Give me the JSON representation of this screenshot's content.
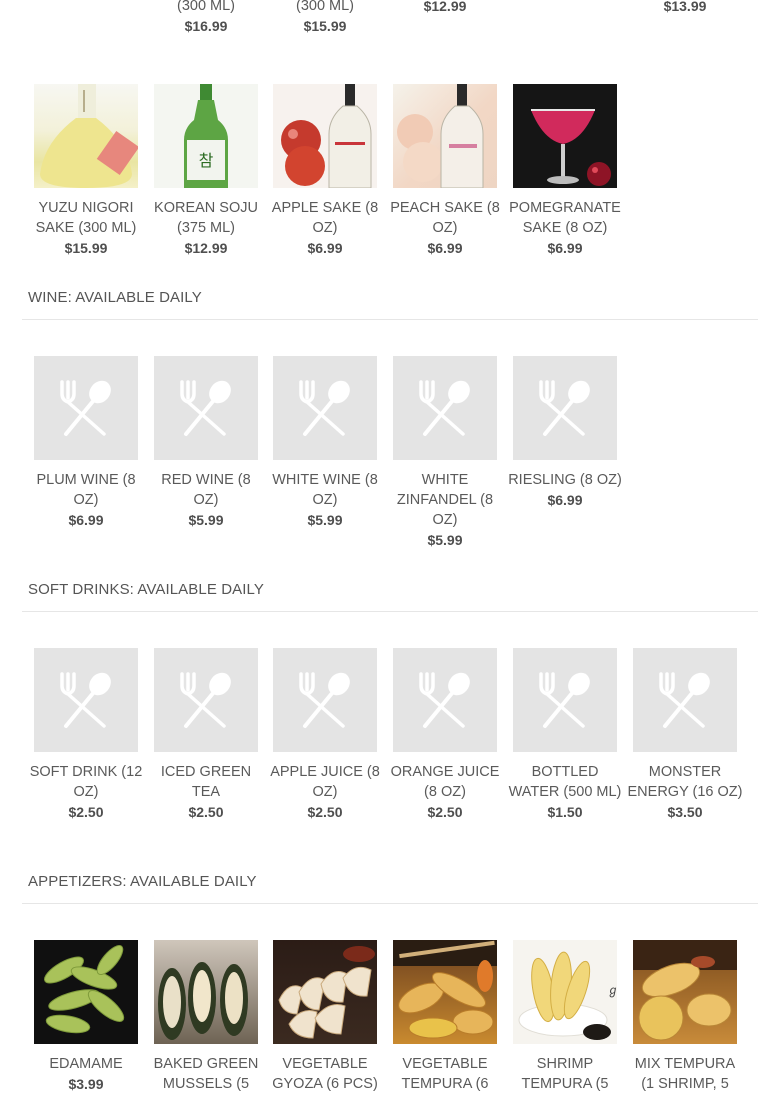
{
  "top_row": [
    {
      "name": "(300 ML)",
      "price": "$16.99"
    },
    {
      "name": "(300 ML)",
      "price": "$15.99"
    },
    {
      "name": "",
      "price": "$12.99"
    },
    {
      "name": "",
      "price": "$13.99"
    }
  ],
  "sake_items": [
    {
      "name": "YUZU NIGORI SAKE (300 ML)",
      "price": "$15.99",
      "image": "yuzu-sake-bottle-photo"
    },
    {
      "name": "KOREAN SOJU (375 ML)",
      "price": "$12.99",
      "image": "soju-bottle-photo"
    },
    {
      "name": "APPLE SAKE (8 OZ)",
      "price": "$6.99",
      "image": "apple-sake-photo"
    },
    {
      "name": "PEACH SAKE (8 OZ)",
      "price": "$6.99",
      "image": "peach-sake-photo"
    },
    {
      "name": "POMEGRANATE SAKE (8 OZ)",
      "price": "$6.99",
      "image": "pomegranate-sake-photo"
    }
  ],
  "wine": {
    "title": "WINE: AVAILABLE DAILY",
    "items": [
      {
        "name": "PLUM WINE (8 OZ)",
        "price": "$6.99"
      },
      {
        "name": "RED WINE (8 OZ)",
        "price": "$5.99"
      },
      {
        "name": "WHITE WINE (8 OZ)",
        "price": "$5.99"
      },
      {
        "name": "WHITE ZINFANDEL (8 OZ)",
        "price": "$5.99"
      },
      {
        "name": "RIESLING (8 OZ)",
        "price": "$6.99"
      }
    ]
  },
  "soft_drinks": {
    "title": "SOFT DRINKS: AVAILABLE DAILY",
    "items": [
      {
        "name": "SOFT DRINK (12 OZ)",
        "price": "$2.50"
      },
      {
        "name": "ICED GREEN TEA",
        "price": "$2.50"
      },
      {
        "name": "APPLE JUICE (8 OZ)",
        "price": "$2.50"
      },
      {
        "name": "ORANGE JUICE (8 OZ)",
        "price": "$2.50"
      },
      {
        "name": "BOTTLED WATER (500 ML)",
        "price": "$1.50"
      },
      {
        "name": "MONSTER ENERGY (16 OZ)",
        "price": "$3.50"
      }
    ]
  },
  "appetizers": {
    "title": "APPETIZERS: AVAILABLE DAILY",
    "items": [
      {
        "name": "EDAMAME",
        "price": "$3.99",
        "image": "edamame-photo"
      },
      {
        "name": "BAKED GREEN MUSSELS (5",
        "price": "",
        "image": "mussels-photo"
      },
      {
        "name": "VEGETABLE GYOZA (6 PCS)",
        "price": "",
        "image": "gyoza-photo"
      },
      {
        "name": "VEGETABLE TEMPURA (6",
        "price": "",
        "image": "vegetable-tempura-photo"
      },
      {
        "name": "SHRIMP TEMPURA (5",
        "price": "",
        "image": "shrimp-tempura-photo"
      },
      {
        "name": "MIX TEMPURA (1 SHRIMP, 5",
        "price": "",
        "image": "mix-tempura-photo"
      }
    ]
  },
  "colors": {
    "placeholder_bg": "#e4e4e4",
    "text": "#555555",
    "divider": "#e6e6e6"
  },
  "icons": {
    "placeholder": "fork-spoon-icon"
  }
}
